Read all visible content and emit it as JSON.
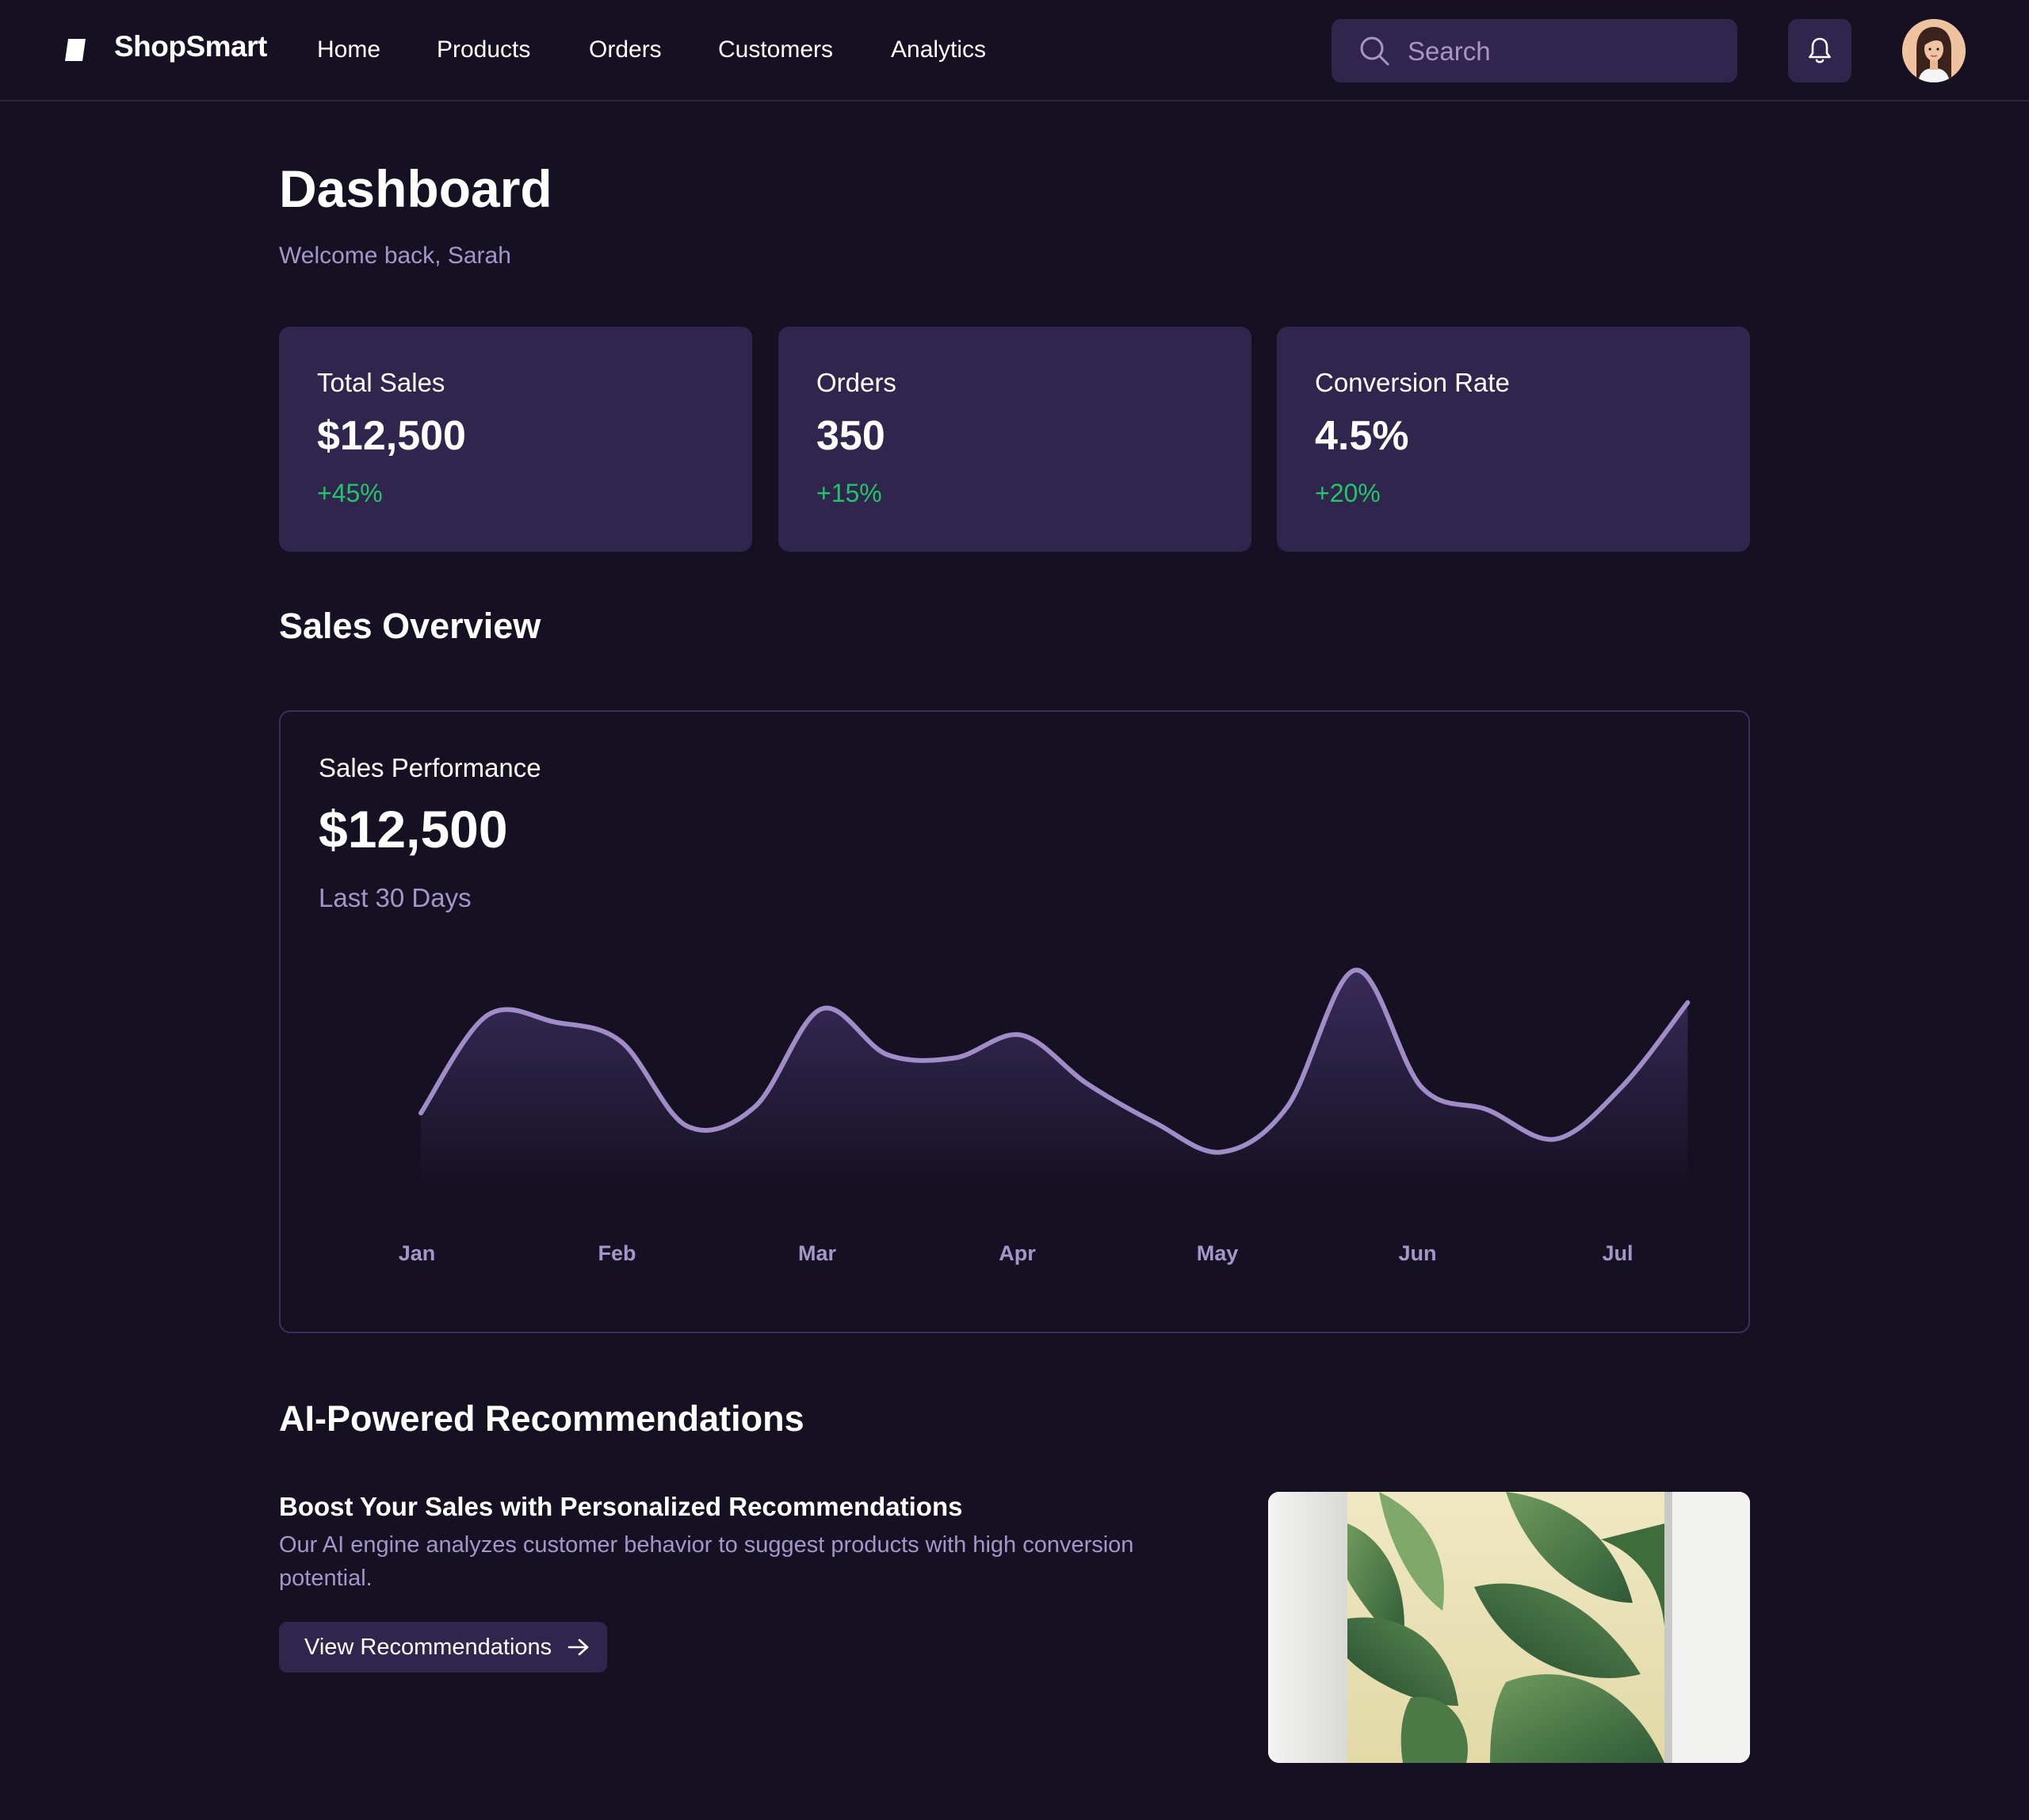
{
  "header": {
    "brand": "ShopSmart",
    "nav": [
      "Home",
      "Products",
      "Orders",
      "Customers",
      "Analytics"
    ],
    "search_placeholder": "Search",
    "icons": [
      "logo-icon",
      "search-icon",
      "bell-icon",
      "avatar"
    ]
  },
  "page": {
    "title": "Dashboard",
    "subtitle": "Welcome back, Sarah"
  },
  "stats": [
    {
      "label": "Total Sales",
      "value": "$12,500",
      "change": "+45%"
    },
    {
      "label": "Orders",
      "value": "350",
      "change": "+15%"
    },
    {
      "label": "Conversion Rate",
      "value": "4.5%",
      "change": "+20%"
    }
  ],
  "sales_overview": {
    "section_title": "Sales Overview",
    "card_label": "Sales Performance",
    "card_value": "$12,500",
    "card_period": "Last 30 Days"
  },
  "chart_data": {
    "type": "area",
    "categories": [
      "Jan",
      "Feb",
      "Mar",
      "Apr",
      "May",
      "Jun",
      "Jul"
    ],
    "x": [
      0,
      0.33,
      0.67,
      1,
      1.33,
      1.67,
      2,
      2.33,
      2.67,
      3,
      3.33,
      3.67,
      4,
      4.33,
      4.67,
      5,
      5.33,
      5.67,
      6,
      6.33
    ],
    "values": [
      18,
      48,
      46,
      40,
      14,
      20,
      50,
      36,
      35,
      42,
      27,
      15,
      6,
      20,
      62,
      26,
      19,
      10,
      26,
      52
    ],
    "xlabel": "",
    "ylabel": "",
    "grid": false,
    "colors": {
      "line": "#a08dc8",
      "fill_top": "#3a2d5c"
    }
  },
  "recommendations": {
    "section_title": "AI-Powered Recommendations",
    "heading": "Boost Your Sales with Personalized Recommendations",
    "body": "Our AI engine analyzes customer behavior to suggest products with high conversion potential.",
    "button_label": "View Recommendations",
    "image": "green-leaves-picture"
  },
  "colors": {
    "background": "#151123",
    "card": "#30254c",
    "muted_text": "#a596c9",
    "positive": "#22c56a"
  }
}
